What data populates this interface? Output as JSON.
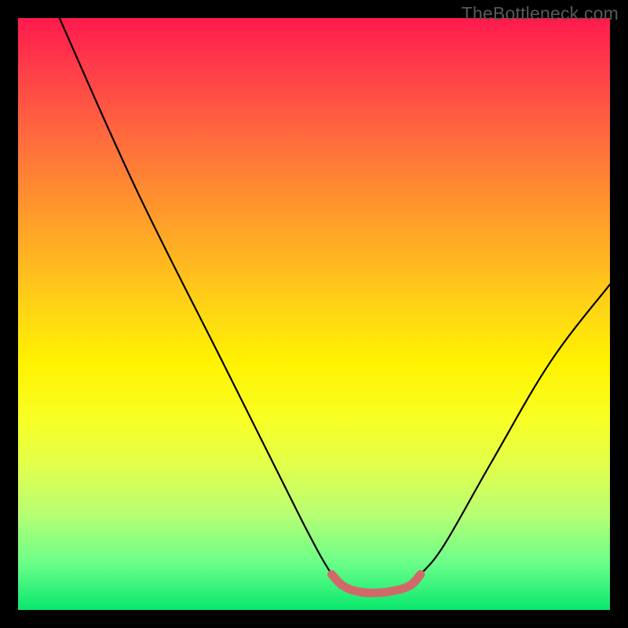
{
  "watermark": "TheBottleneck.com",
  "chart_data": {
    "type": "line",
    "title": "",
    "xlabel": "",
    "ylabel": "",
    "xlim": [
      0,
      100
    ],
    "ylim": [
      0,
      100
    ],
    "background_gradient": {
      "direction": "vertical",
      "stops": [
        {
          "pos": 0,
          "color": "#ff1a4c"
        },
        {
          "pos": 50,
          "color": "#ffd814"
        },
        {
          "pos": 100,
          "color": "#09e86d"
        }
      ]
    },
    "series": [
      {
        "name": "bottleneck-curve",
        "color": "#000000",
        "points": [
          {
            "x": 7,
            "y": 100
          },
          {
            "x": 20,
            "y": 71
          },
          {
            "x": 35,
            "y": 41
          },
          {
            "x": 48,
            "y": 15
          },
          {
            "x": 53,
            "y": 6
          },
          {
            "x": 55,
            "y": 4
          },
          {
            "x": 58,
            "y": 3
          },
          {
            "x": 62,
            "y": 3
          },
          {
            "x": 66,
            "y": 4
          },
          {
            "x": 68,
            "y": 6
          },
          {
            "x": 72,
            "y": 11
          },
          {
            "x": 80,
            "y": 25
          },
          {
            "x": 90,
            "y": 42
          },
          {
            "x": 100,
            "y": 55
          }
        ]
      },
      {
        "name": "valley-highlight",
        "color": "#d86a6a",
        "thickness": 10,
        "points": [
          {
            "x": 53,
            "y": 6
          },
          {
            "x": 55,
            "y": 4
          },
          {
            "x": 58,
            "y": 3
          },
          {
            "x": 62,
            "y": 3
          },
          {
            "x": 66,
            "y": 4
          },
          {
            "x": 68,
            "y": 6
          }
        ]
      }
    ]
  }
}
